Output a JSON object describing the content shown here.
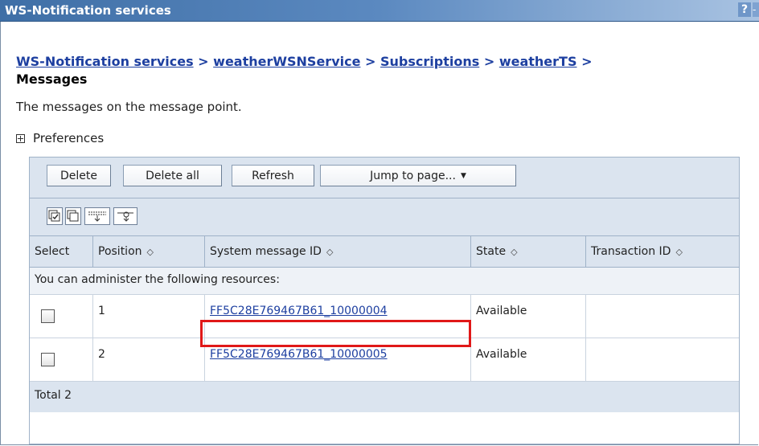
{
  "window": {
    "title": "WS-Notification services",
    "help_label": "?",
    "minimize_label": "-"
  },
  "breadcrumb": {
    "items": [
      "WS-Notification services",
      "weatherWSNService",
      "Subscriptions",
      "weatherTS"
    ],
    "separator": ">",
    "current": "Messages"
  },
  "description": "The messages on the message point.",
  "preferences_label": "Preferences",
  "toolbar": {
    "delete_label": "Delete",
    "delete_all_label": "Delete all",
    "refresh_label": "Refresh",
    "jump_label": "Jump to page...",
    "jump_caret": "▼"
  },
  "icon_tools": [
    {
      "icon": "select-all-icon"
    },
    {
      "icon": "deselect-all-icon"
    },
    {
      "icon": "show-filter-icon"
    },
    {
      "icon": "clear-filter-icon"
    }
  ],
  "table": {
    "columns": [
      "Select",
      "Position",
      "System message ID",
      "State",
      "Transaction ID"
    ],
    "sort_glyph": "◇",
    "admin_text": "You can administer the following resources:",
    "rows": [
      {
        "position": "1",
        "message_id": "FF5C28E769467B61_10000004",
        "state": "Available",
        "transaction_id": ""
      },
      {
        "position": "2",
        "message_id": "FF5C28E769467B61_10000005",
        "state": "Available",
        "transaction_id": ""
      }
    ],
    "total": "Total 2"
  },
  "colors": {
    "titlebar": "#3f6fa6",
    "link": "#1d3fa0",
    "highlight": "#e01818",
    "table_header": "#dbe4ef"
  }
}
